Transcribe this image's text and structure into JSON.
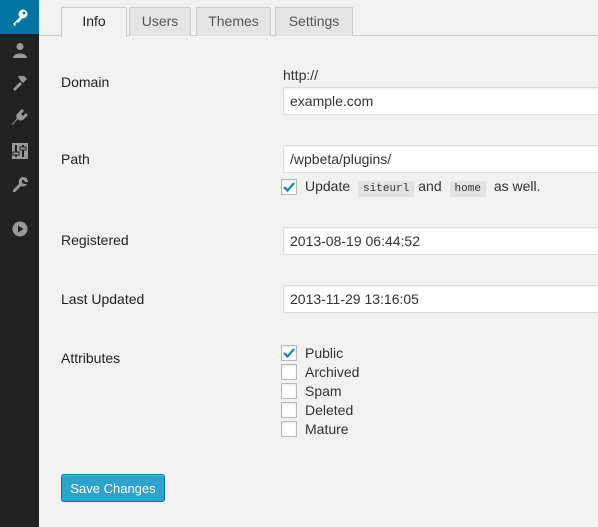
{
  "sidebar": {
    "icons": [
      "key-icon",
      "user-icon",
      "hammer-icon",
      "plugin-icon",
      "settings-sliders-icon",
      "wrench-icon",
      "play-icon"
    ]
  },
  "tabs": [
    {
      "label": "Info",
      "active": true
    },
    {
      "label": "Users",
      "active": false
    },
    {
      "label": "Themes",
      "active": false
    },
    {
      "label": "Settings",
      "active": false
    }
  ],
  "form": {
    "domain": {
      "label": "Domain",
      "prefix": "http://",
      "value": "example.com"
    },
    "path": {
      "label": "Path",
      "value": "/wpbeta/plugins/",
      "update_text_1": "Update",
      "code_1": "siteurl",
      "update_text_2": "and",
      "code_2": "home",
      "update_text_3": "as well.",
      "update_checked": true
    },
    "registered": {
      "label": "Registered",
      "value": "2013-08-19 06:44:52"
    },
    "last_updated": {
      "label": "Last Updated",
      "value": "2013-11-29 13:16:05"
    },
    "attributes": {
      "label": "Attributes",
      "items": [
        {
          "label": "Public",
          "checked": true
        },
        {
          "label": "Archived",
          "checked": false
        },
        {
          "label": "Spam",
          "checked": false
        },
        {
          "label": "Deleted",
          "checked": false
        },
        {
          "label": "Mature",
          "checked": false
        }
      ]
    }
  },
  "save_button": "Save Changes",
  "colors": {
    "sidebar_bg": "#222222",
    "active_blue": "#0074a2",
    "button_blue": "#2ea2cc",
    "check_blue": "#1e8cbe"
  }
}
